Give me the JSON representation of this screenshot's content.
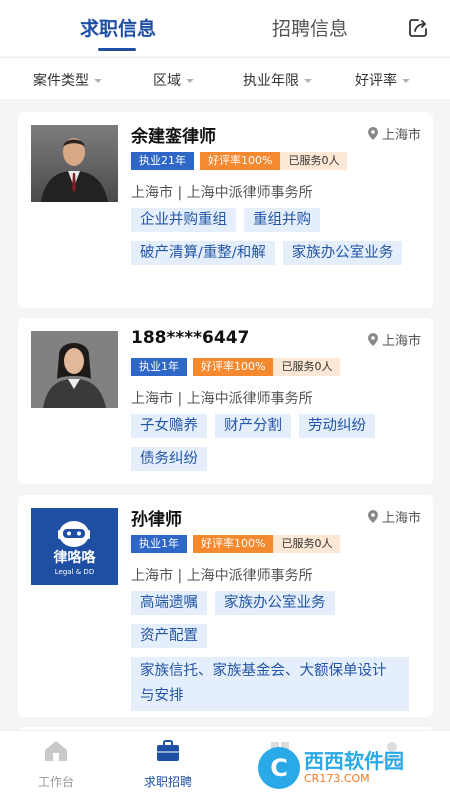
{
  "header": {
    "tabs": [
      {
        "label": "求职信息",
        "active": true
      },
      {
        "label": "招聘信息",
        "active": false
      }
    ],
    "share_icon": "share-icon",
    "accent_color": "#1e4fa3"
  },
  "filters": [
    {
      "label": "案件类型"
    },
    {
      "label": "区域"
    },
    {
      "label": "执业年限"
    },
    {
      "label": "好评率"
    }
  ],
  "lawyers": [
    {
      "name": "余建銮律师",
      "location": "上海市",
      "years_badge": "执业21年",
      "rating_badge": "好评率100%",
      "served_badge": "已服务0人",
      "firm_line": "上海市 | 上海中派律师事务所",
      "tags": [
        "企业并购重组",
        "重组并购",
        "破产清算/重整/和解",
        "家族办公室业务"
      ]
    },
    {
      "name": "188****6447",
      "location": "上海市",
      "years_badge": "执业1年",
      "rating_badge": "好评率100%",
      "served_badge": "已服务0人",
      "firm_line": "上海市 | 上海中派律师事务所",
      "tags": [
        "子女赡养",
        "财产分割",
        "劳动纠纷",
        "债务纠纷"
      ]
    },
    {
      "name": "孙律师",
      "location": "上海市",
      "years_badge": "执业1年",
      "rating_badge": "好评率100%",
      "served_badge": "已服务0人",
      "firm_line": "上海市 | 上海中派律师事务所",
      "logo_text": "律咯咯",
      "logo_sub": "Legal & DD",
      "tags": [
        "高端遗嘱",
        "家族办公室业务",
        "资产配置",
        "家族信托、家族基金会、大额保单设计与安排"
      ]
    }
  ],
  "bottom_nav": [
    {
      "label": "工作台",
      "icon": "home-icon"
    },
    {
      "label": "求职招聘",
      "icon": "briefcase-icon",
      "active": true
    }
  ],
  "watermark": {
    "circle": "C",
    "title": "西西软件园",
    "url": "CR173.COM"
  }
}
